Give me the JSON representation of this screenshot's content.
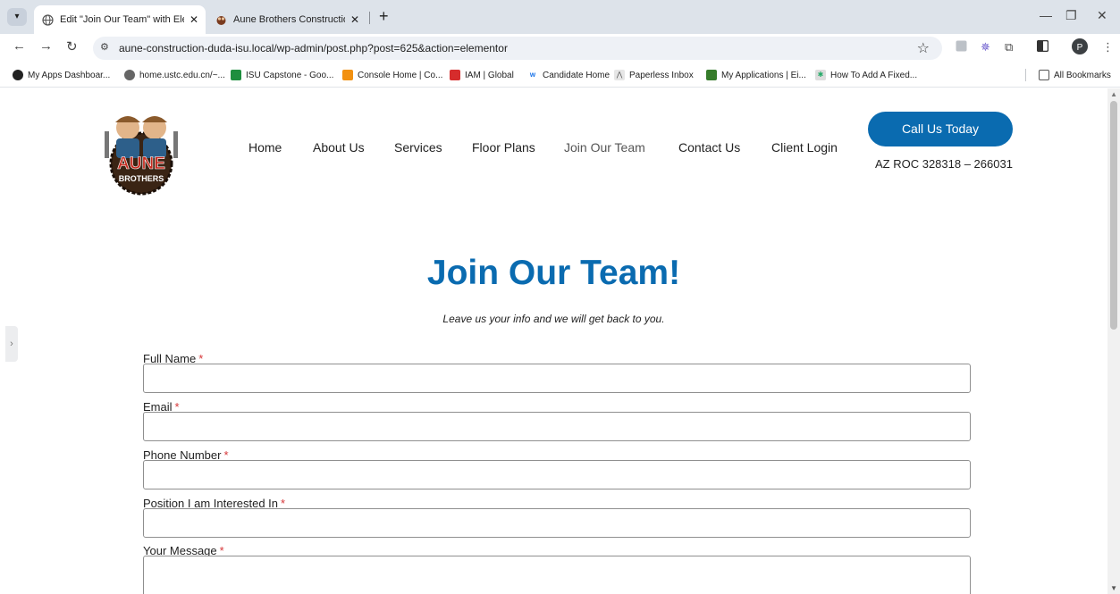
{
  "browser": {
    "tabs": [
      {
        "title": "Edit \"Join Our Team\" with Eleme",
        "close": "✕"
      },
      {
        "title": "Aune Brothers Construction",
        "close": "✕"
      }
    ],
    "new_tab": "+",
    "url": "aune-construction-duda-isu.local/wp-admin/post.php?post=625&action=elementor",
    "profile_initial": "P",
    "bookmarks": [
      {
        "label": "My Apps Dashboar..."
      },
      {
        "label": "home.ustc.edu.cn/~..."
      },
      {
        "label": "ISU Capstone - Goo..."
      },
      {
        "label": "Console Home | Co..."
      },
      {
        "label": "IAM | Global"
      },
      {
        "label": "Candidate Home"
      },
      {
        "label": "Paperless Inbox"
      },
      {
        "label": "My Applications | Ei..."
      },
      {
        "label": "How To Add A Fixed..."
      }
    ],
    "all_bookmarks": "All Bookmarks"
  },
  "site": {
    "logo": {
      "top_text": "AUNE",
      "bottom_text": "BROTHERS"
    },
    "nav": [
      "Home",
      "About Us",
      "Services",
      "Floor Plans",
      "Join Our Team",
      "Contact Us",
      "Client Login"
    ],
    "active_nav": "Join Our Team",
    "cta_label": "Call Us Today",
    "license": "AZ ROC 328318 – 266031",
    "brand_color": "#0a6bb0"
  },
  "form": {
    "title": "Join Our Team!",
    "subtitle": "Leave us your info and we will get back to you.",
    "required_mark": "*",
    "fields": [
      {
        "label": "Full Name",
        "value": ""
      },
      {
        "label": "Email",
        "value": ""
      },
      {
        "label": "Phone Number",
        "value": ""
      },
      {
        "label": "Position I am Interested In",
        "value": ""
      },
      {
        "label": "Your Message",
        "value": ""
      }
    ]
  },
  "icons": {
    "tab_search": "chevron-down-icon",
    "back": "arrow-left-icon",
    "forward": "arrow-right-icon",
    "reload": "reload-icon",
    "bookmark_star": "star-icon"
  }
}
